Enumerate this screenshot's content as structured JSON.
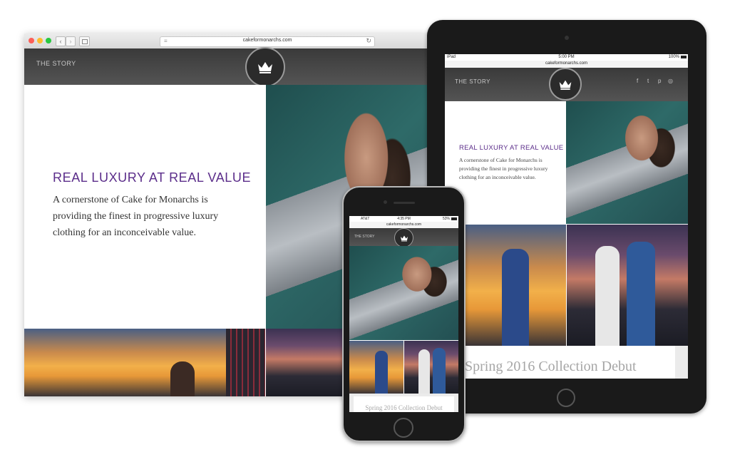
{
  "browser": {
    "url": "cakeformonarchs.com"
  },
  "desktop": {
    "nav_label": "THE STORY",
    "heading": "REAL LUXURY AT REAL VALUE",
    "body": "A cornerstone of Cake for Monarchs is providing the finest in progressive luxury clothing for an inconceivable value."
  },
  "tablet": {
    "status": {
      "device": "iPad",
      "time": "5:00 PM",
      "battery": "100%"
    },
    "url": "cakeformonarchs.com",
    "nav_label": "THE STORY",
    "heading": "REAL LUXURY AT REAL VALUE",
    "body": "A cornerstone of Cake for Monarchs is providing the finest in progressive luxury clothing for an inconceivable value.",
    "collection_title": "Spring 2016 Collection Debut"
  },
  "phone": {
    "status": {
      "carrier": "AT&T",
      "time": "4:35 PM",
      "battery": "53%"
    },
    "url": "cakeformonarchs.com",
    "nav_label": "THE STORY",
    "collection_title": "Spring 2016 Collection Debut"
  },
  "icons": {
    "social": [
      "facebook-icon",
      "twitter-icon",
      "pinterest-icon",
      "instagram-icon"
    ],
    "social_glyphs": [
      "f",
      "t",
      "p",
      "◎"
    ]
  },
  "colors": {
    "heading_purple": "#5b2d8a",
    "device_black": "#1a1a1a"
  }
}
